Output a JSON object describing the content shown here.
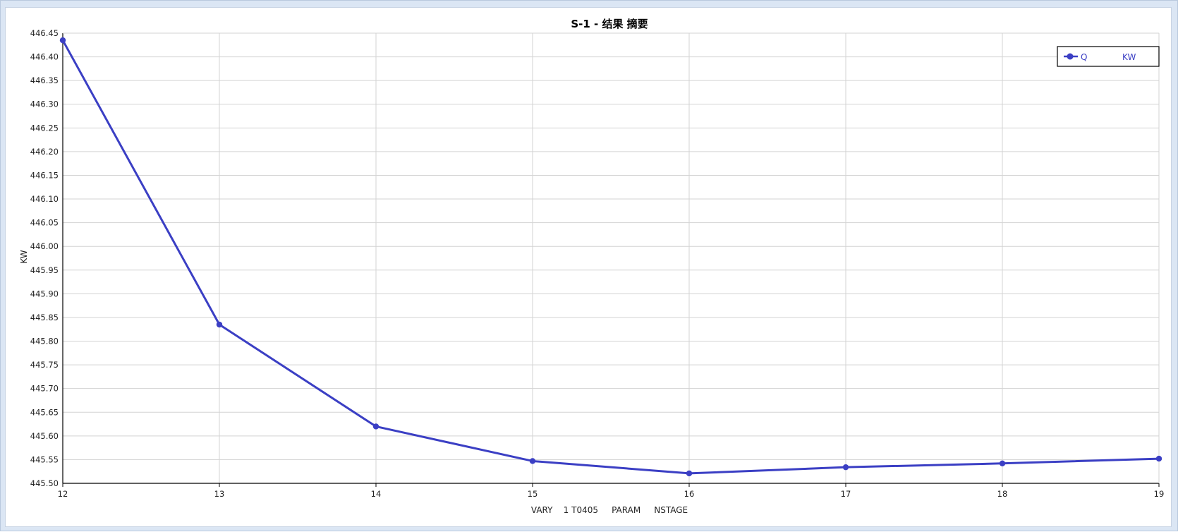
{
  "chart_data": {
    "type": "line",
    "title": "S-1 - 结果 摘要",
    "xlabel": "VARY    1 T0405     PARAM     NSTAGE",
    "ylabel": "KW",
    "xlim": [
      12,
      19
    ],
    "ylim": [
      445.5,
      446.45
    ],
    "x_ticks": [
      "12",
      "13",
      "14",
      "15",
      "16",
      "17",
      "18",
      "19"
    ],
    "y_ticks": [
      "445.50",
      "445.55",
      "445.60",
      "445.65",
      "445.70",
      "445.75",
      "445.80",
      "445.85",
      "445.90",
      "445.95",
      "446.00",
      "446.05",
      "446.10",
      "446.15",
      "446.20",
      "446.25",
      "446.30",
      "446.35",
      "446.40",
      "446.45"
    ],
    "grid": true,
    "legend_position": "top-right",
    "series": [
      {
        "name": "Q",
        "unit": "KW",
        "color": "#3b3fc4",
        "x": [
          12,
          13,
          14,
          15,
          16,
          17,
          18,
          19
        ],
        "values": [
          446.435,
          445.835,
          445.62,
          445.547,
          445.521,
          445.534,
          445.542,
          445.552
        ]
      }
    ]
  }
}
